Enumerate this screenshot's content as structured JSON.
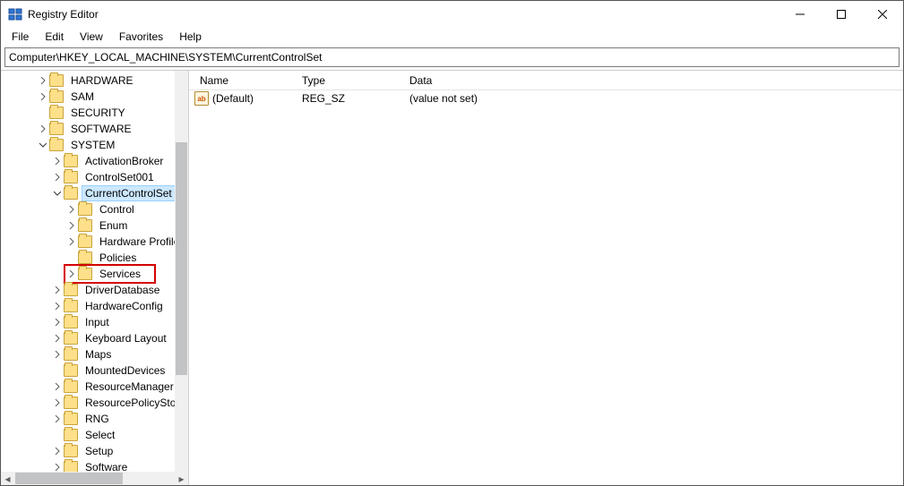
{
  "title": "Registry Editor",
  "menu": {
    "file": "File",
    "edit": "Edit",
    "view": "View",
    "favorites": "Favorites",
    "help": "Help"
  },
  "address": "Computer\\HKEY_LOCAL_MACHINE\\SYSTEM\\CurrentControlSet",
  "tree": {
    "hardware": "HARDWARE",
    "sam": "SAM",
    "security": "SECURITY",
    "software": "SOFTWARE",
    "system": "SYSTEM",
    "activationbroker": "ActivationBroker",
    "controlset001": "ControlSet001",
    "currentcontrolset": "CurrentControlSet",
    "control": "Control",
    "enum": "Enum",
    "hardwareprofiles": "Hardware Profiles",
    "policies": "Policies",
    "services": "Services",
    "driverdatabase": "DriverDatabase",
    "hardwareconfig": "HardwareConfig",
    "input": "Input",
    "keyboardlayout": "Keyboard Layout",
    "maps": "Maps",
    "mounteddevices": "MountedDevices",
    "resourcemanager": "ResourceManager",
    "resourcepolicystore": "ResourcePolicyStore",
    "rng": "RNG",
    "select": "Select",
    "setup": "Setup",
    "software2": "Software"
  },
  "list": {
    "headers": {
      "name": "Name",
      "type": "Type",
      "data": "Data"
    },
    "rows": [
      {
        "name": "(Default)",
        "type": "REG_SZ",
        "data": "(value not set)"
      }
    ]
  },
  "value_icon_text": "ab"
}
